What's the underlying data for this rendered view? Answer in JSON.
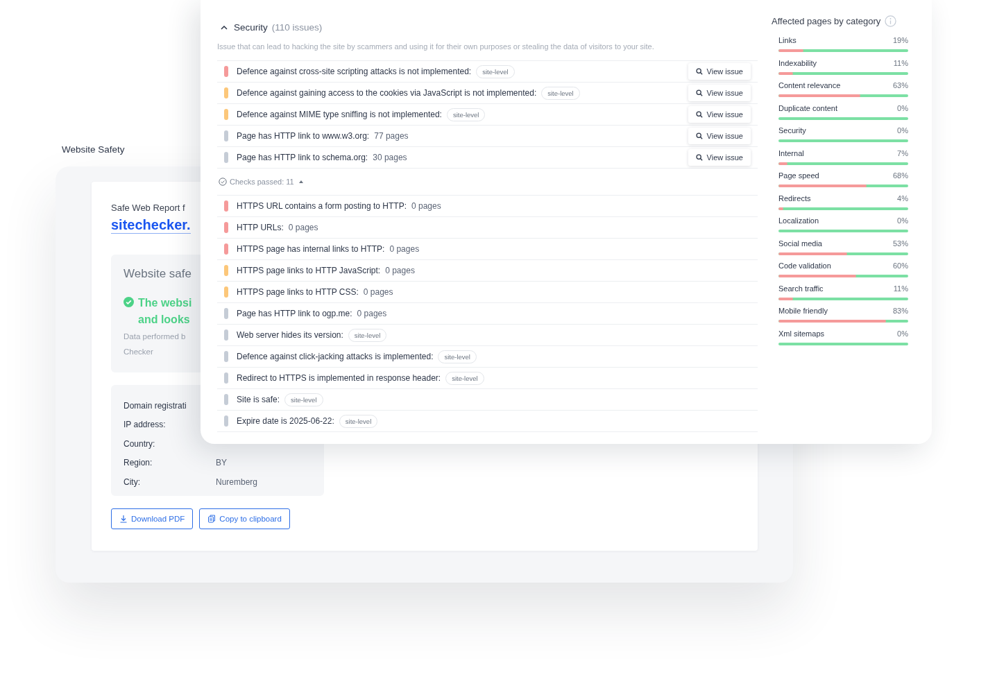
{
  "back": {
    "title": "Website Safety",
    "report": {
      "heading": "Safe Web Report f",
      "site_link": "sitechecker.",
      "summary": {
        "title": "Website safe",
        "status_ok": true,
        "status_lines": [
          "The websi",
          "and looks"
        ],
        "note_lines": [
          "Data performed b",
          "Checker"
        ]
      },
      "details": [
        {
          "label": "Domain registrati"
        },
        {
          "label": "IP address:"
        },
        {
          "label": "Country:"
        },
        {
          "label": "Region:",
          "value": "BY"
        },
        {
          "label": "City:",
          "value": "Nuremberg"
        }
      ],
      "buttons": [
        {
          "kind": "download",
          "label": "Download PDF"
        },
        {
          "kind": "copy",
          "label": "Copy to clipboard"
        }
      ]
    }
  },
  "security": {
    "title": "Security",
    "count": "(110 issues)",
    "expanded": true,
    "description": "Issue that can lead to hacking the site by scammers and using it for their own purposes or stealing the data of visitors to your site.",
    "issues": [
      {
        "color": "#f59a9a",
        "label": "Defence against cross-site scripting attacks is not implemented:",
        "tag": "site-level",
        "action": "View issue"
      },
      {
        "color": "#fcc77a",
        "label": "Defence against gaining access to the cookies via JavaScript is not implemented:",
        "tag": "site-level",
        "action": "View issue"
      },
      {
        "color": "#fcc77a",
        "label": "Defence against MIME type sniffing is not implemented:",
        "tag": "site-level",
        "action": "View issue"
      },
      {
        "color": "#c5ccd6",
        "label": "Page has HTTP link to www.w3.org:",
        "count": "77 pages",
        "action": "View issue"
      },
      {
        "color": "#c5ccd6",
        "label": "Page has HTTP link to schema.org:",
        "count": "30 pages",
        "action": "View issue"
      }
    ],
    "checks_passed": "Checks passed: 11",
    "passed_expanded": true,
    "passed": [
      {
        "color": "#f59a9a",
        "label": "HTTPS URL contains a form posting to HTTP:",
        "count": "0 pages"
      },
      {
        "color": "#f59a9a",
        "label": "HTTP URLs:",
        "count": "0 pages"
      },
      {
        "color": "#f59a9a",
        "label": "HTTPS page has internal links to HTTP:",
        "count": "0 pages"
      },
      {
        "color": "#fcc77a",
        "label": "HTTPS page links to HTTP JavaScript:",
        "count": "0 pages"
      },
      {
        "color": "#fcc77a",
        "label": "HTTPS page links to HTTP CSS:",
        "count": "0 pages"
      },
      {
        "color": "#c5ccd6",
        "label": "Page has HTTP link to ogp.me:",
        "count": "0 pages"
      },
      {
        "color": "#c5ccd6",
        "label": "Web server hides its version:",
        "tag": "site-level"
      },
      {
        "color": "#c5ccd6",
        "label": "Defence against click-jacking attacks is implemented:",
        "tag": "site-level"
      },
      {
        "color": "#c5ccd6",
        "label": "Redirect to HTTPS is implemented in response header:",
        "tag": "site-level"
      },
      {
        "color": "#c5ccd6",
        "label": "Site is safe:",
        "tag": "site-level"
      },
      {
        "color": "#c5ccd6",
        "label": "Expire date is 2025-06-22:",
        "tag": "site-level"
      }
    ]
  },
  "categories": {
    "title": "Affected pages by category",
    "items": [
      {
        "name": "Links",
        "reading": "19%",
        "level": 0.19
      },
      {
        "name": "Indexability",
        "reading": "11%",
        "level": 0.11
      },
      {
        "name": "Content relevance",
        "reading": "63%",
        "level": 0.63
      },
      {
        "name": "Duplicate content",
        "reading": "0%",
        "level": 0
      },
      {
        "name": "Security",
        "reading": "0%",
        "level": 0
      },
      {
        "name": "Internal",
        "reading": "7%",
        "level": 0.07
      },
      {
        "name": "Page speed",
        "reading": "68%",
        "level": 0.68
      },
      {
        "name": "Redirects",
        "reading": "4%",
        "level": 0.04
      },
      {
        "name": "Localization",
        "reading": "0%",
        "level": 0
      },
      {
        "name": "Social media",
        "reading": "53%",
        "level": 0.53
      },
      {
        "name": "Code validation",
        "reading": "60%",
        "level": 0.6
      },
      {
        "name": "Search traffic",
        "reading": "11%",
        "level": 0.11
      },
      {
        "name": "Mobile friendly",
        "reading": "83%",
        "level": 0.83
      },
      {
        "name": "Xml sitemaps",
        "reading": "0%",
        "level": 0
      }
    ]
  }
}
